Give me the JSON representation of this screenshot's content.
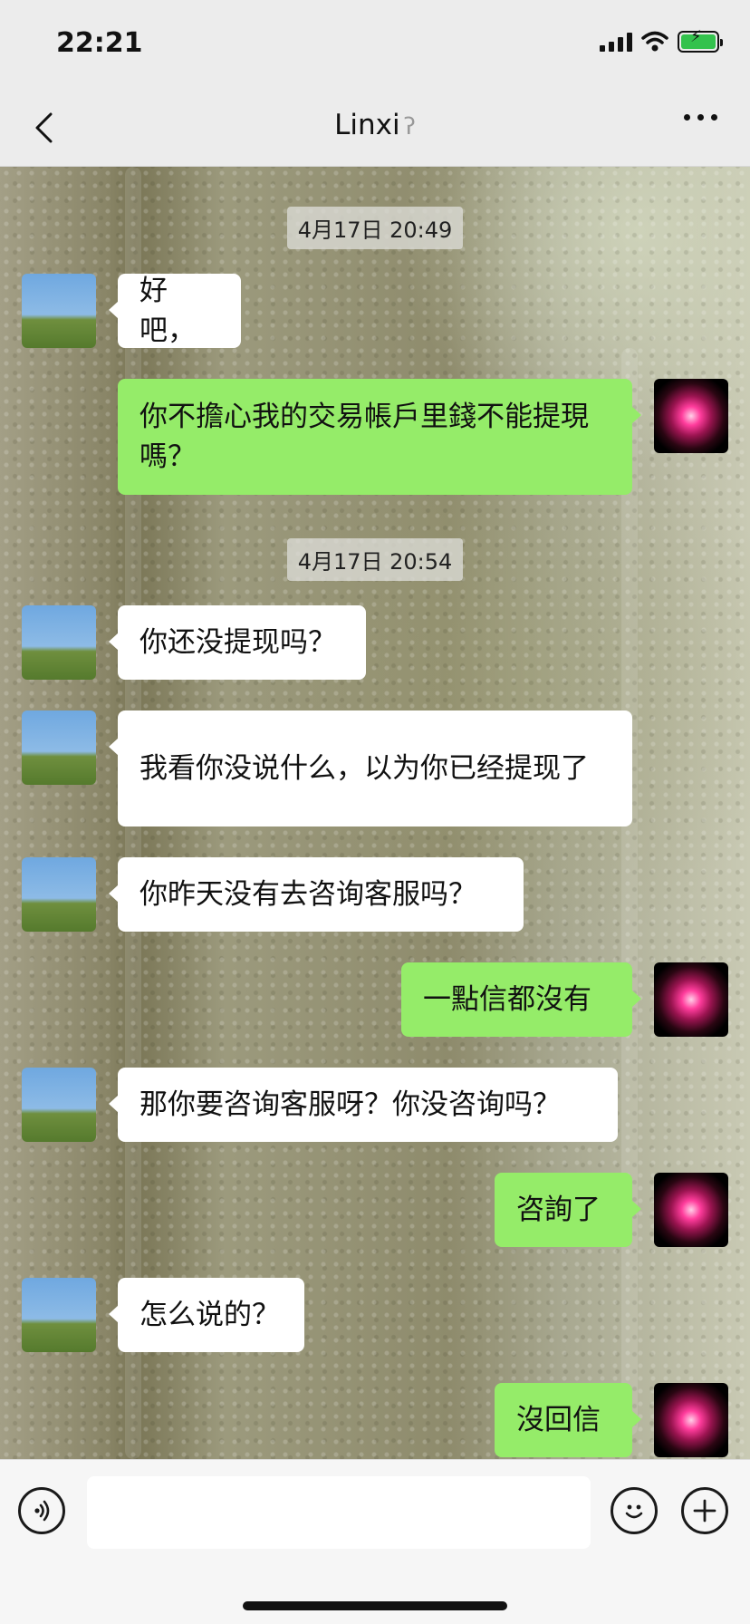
{
  "status_bar": {
    "time": "22:21"
  },
  "nav": {
    "title": "Linxi",
    "ear_icon": "ear-icon"
  },
  "colors": {
    "incoming_bubble": "#ffffff",
    "outgoing_bubble": "#95ec69",
    "header_bg": "#ececec"
  },
  "timestamps": [
    "4月17日 20:49",
    "4月17日 20:54"
  ],
  "messages": [
    {
      "side": "in",
      "text": "好吧，"
    },
    {
      "side": "out",
      "text": "你不擔心我的交易帳戶里錢不能提現嗎？"
    },
    {
      "side": "in",
      "text": "你还没提现吗？"
    },
    {
      "side": "in",
      "text": "我看你没说什么，以为你已经提现了"
    },
    {
      "side": "in",
      "text": "你昨天没有去咨询客服吗？"
    },
    {
      "side": "out",
      "text": "一點信都沒有"
    },
    {
      "side": "in",
      "text": "那你要咨询客服呀？你没咨询吗？"
    },
    {
      "side": "out",
      "text": "咨詢了"
    },
    {
      "side": "in",
      "text": "怎么说的？"
    },
    {
      "side": "out",
      "text": "沒回信"
    }
  ],
  "input": {
    "value": "",
    "placeholder": ""
  }
}
